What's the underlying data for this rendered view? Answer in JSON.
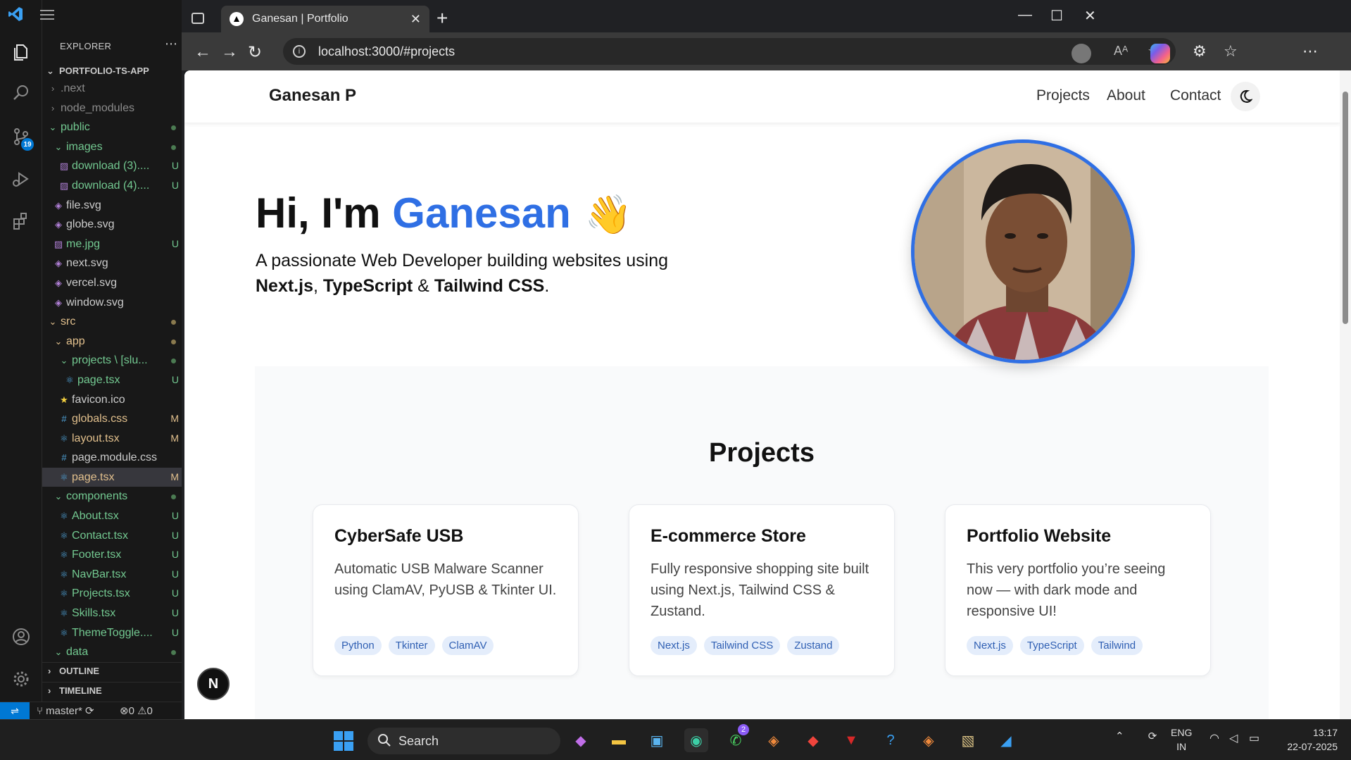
{
  "vscode": {
    "explorer_title": "EXPLORER",
    "project": "PORTFOLIO-TS-APP",
    "tree": [
      {
        "label": ".next",
        "depth": 0,
        "kind": "folder-closed",
        "color": "grey",
        "badge": ""
      },
      {
        "label": "node_modules",
        "depth": 0,
        "kind": "folder-closed",
        "color": "grey",
        "badge": ""
      },
      {
        "label": "public",
        "depth": 0,
        "kind": "folder-open",
        "color": "green",
        "badge": "dot"
      },
      {
        "label": "images",
        "depth": 1,
        "kind": "folder-open",
        "color": "green",
        "badge": "dot"
      },
      {
        "label": "download (3)....",
        "depth": 2,
        "kind": "image",
        "color": "green",
        "badge": "U"
      },
      {
        "label": "download (4)....",
        "depth": 2,
        "kind": "image",
        "color": "green",
        "badge": "U"
      },
      {
        "label": "file.svg",
        "depth": 1,
        "kind": "svg",
        "color": "file",
        "badge": ""
      },
      {
        "label": "globe.svg",
        "depth": 1,
        "kind": "svg",
        "color": "file",
        "badge": ""
      },
      {
        "label": "me.jpg",
        "depth": 1,
        "kind": "image",
        "color": "green",
        "badge": "U"
      },
      {
        "label": "next.svg",
        "depth": 1,
        "kind": "svg",
        "color": "file",
        "badge": ""
      },
      {
        "label": "vercel.svg",
        "depth": 1,
        "kind": "svg",
        "color": "file",
        "badge": ""
      },
      {
        "label": "window.svg",
        "depth": 1,
        "kind": "svg",
        "color": "file",
        "badge": ""
      },
      {
        "label": "src",
        "depth": 0,
        "kind": "folder-open",
        "color": "yellow",
        "badge": "dot"
      },
      {
        "label": "app",
        "depth": 1,
        "kind": "folder-open",
        "color": "yellow",
        "badge": "dot"
      },
      {
        "label": "projects \\ [slu...",
        "depth": 2,
        "kind": "folder-open",
        "color": "green",
        "badge": "dot"
      },
      {
        "label": "page.tsx",
        "depth": 3,
        "kind": "react",
        "color": "green",
        "badge": "U"
      },
      {
        "label": "favicon.ico",
        "depth": 2,
        "kind": "star",
        "color": "file",
        "badge": ""
      },
      {
        "label": "globals.css",
        "depth": 2,
        "kind": "hash",
        "color": "yellow",
        "badge": "M"
      },
      {
        "label": "layout.tsx",
        "depth": 2,
        "kind": "react",
        "color": "yellow",
        "badge": "M"
      },
      {
        "label": "page.module.css",
        "depth": 2,
        "kind": "hash",
        "color": "file",
        "badge": ""
      },
      {
        "label": "page.tsx",
        "depth": 2,
        "kind": "react",
        "color": "yellow",
        "badge": "M",
        "selected": true
      },
      {
        "label": "components",
        "depth": 1,
        "kind": "folder-open",
        "color": "green",
        "badge": "dot"
      },
      {
        "label": "About.tsx",
        "depth": 2,
        "kind": "react",
        "color": "green",
        "badge": "U"
      },
      {
        "label": "Contact.tsx",
        "depth": 2,
        "kind": "react",
        "color": "green",
        "badge": "U"
      },
      {
        "label": "Footer.tsx",
        "depth": 2,
        "kind": "react",
        "color": "green",
        "badge": "U"
      },
      {
        "label": "NavBar.tsx",
        "depth": 2,
        "kind": "react",
        "color": "green",
        "badge": "U"
      },
      {
        "label": "Projects.tsx",
        "depth": 2,
        "kind": "react",
        "color": "green",
        "badge": "U"
      },
      {
        "label": "Skills.tsx",
        "depth": 2,
        "kind": "react",
        "color": "green",
        "badge": "U"
      },
      {
        "label": "ThemeToggle....",
        "depth": 2,
        "kind": "react",
        "color": "green",
        "badge": "U"
      },
      {
        "label": "data",
        "depth": 1,
        "kind": "folder-open",
        "color": "green",
        "badge": "dot"
      }
    ],
    "outline": "OUTLINE",
    "timeline": "TIMELINE",
    "branch": "master*",
    "errors": "0",
    "warnings": "0",
    "scm_badge": "19"
  },
  "browser": {
    "tab_title": "Ganesan | Portfolio",
    "url": "localhost:3000/#projects"
  },
  "page": {
    "brand": "Ganesan P",
    "nav": [
      "Projects",
      "About",
      "Contact"
    ],
    "hero_greeting": "Hi, I'm ",
    "hero_name": "Ganesan",
    "hero_wave": "👋",
    "hero_sub_pre": "A passionate Web Developer building websites using ",
    "hero_tech_1": "Next.js",
    "hero_sep_1": ", ",
    "hero_tech_2": "TypeScript",
    "hero_sep_2": " & ",
    "hero_tech_3": "Tailwind CSS",
    "hero_end": ".",
    "projects_title": "Projects",
    "projects": [
      {
        "title": "CyberSafe USB",
        "desc": "Automatic USB Malware Scanner using ClamAV, PyUSB & Tkinter UI.",
        "tags": [
          "Python",
          "Tkinter",
          "ClamAV"
        ]
      },
      {
        "title": "E-commerce Store",
        "desc": "Fully responsive shopping site built using Next.js, Tailwind CSS & Zustand.",
        "tags": [
          "Next.js",
          "Tailwind CSS",
          "Zustand"
        ]
      },
      {
        "title": "Portfolio Website",
        "desc": "This very portfolio you’re seeing now — with dark mode and responsive UI!",
        "tags": [
          "Next.js",
          "TypeScript",
          "Tailwind"
        ]
      }
    ],
    "next_badge": "N",
    "accent": "#2f6fe4"
  },
  "taskbar": {
    "search": "Search",
    "whatsapp_badge": "2",
    "lang_1": "ENG",
    "lang_2": "IN",
    "time": "13:17",
    "date": "22-07-2025"
  }
}
